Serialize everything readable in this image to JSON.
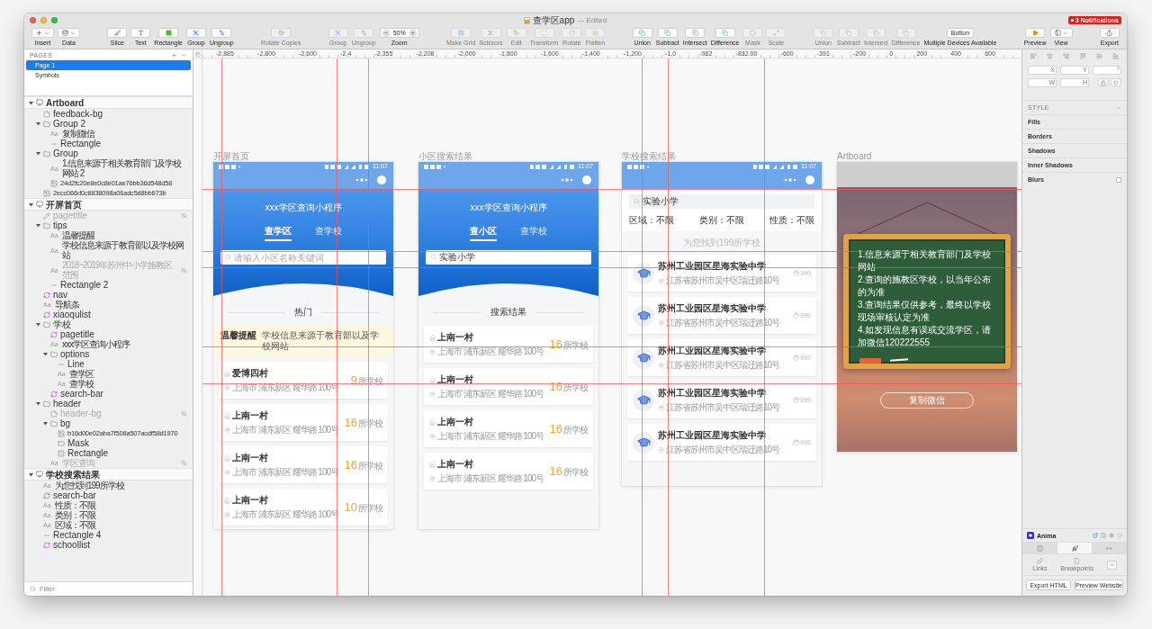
{
  "window": {
    "title": "查学区app",
    "status": "— Edited",
    "notifications": "3 Notifications"
  },
  "toolbar": [
    {
      "items": [
        {
          "label": "Insert",
          "kind": "dropdown",
          "disabled": false
        },
        {
          "label": "Data",
          "kind": "dropdown",
          "disabled": false
        }
      ]
    },
    {
      "items": [
        {
          "label": "Slice",
          "kind": "tool",
          "disabled": false
        },
        {
          "label": "Text",
          "kind": "tool",
          "disabled": false
        },
        {
          "label": "Rectangle",
          "kind": "tool",
          "disabled": false
        },
        {
          "label": "Group",
          "kind": "tool",
          "disabled": false
        },
        {
          "label": "Ungroup",
          "kind": "tool",
          "disabled": false
        }
      ]
    },
    {
      "items": [
        {
          "label": "Rotate Copies",
          "kind": "tool",
          "disabled": true
        }
      ]
    },
    {
      "items": [
        {
          "label": "Group",
          "kind": "tool",
          "disabled": true
        },
        {
          "label": "Ungroup",
          "kind": "tool",
          "disabled": true
        },
        {
          "label": "Zoom",
          "kind": "zoom",
          "value": "50%",
          "disabled": false
        }
      ]
    },
    {
      "items": [
        {
          "label": "Make Grid",
          "kind": "tool",
          "disabled": true
        },
        {
          "label": "Scissors",
          "kind": "tool",
          "disabled": true
        },
        {
          "label": "Edit",
          "kind": "tool",
          "disabled": true
        },
        {
          "label": "Transform",
          "kind": "tool",
          "disabled": true
        },
        {
          "label": "Rotate",
          "kind": "tool",
          "disabled": true
        },
        {
          "label": "Flatten",
          "kind": "tool",
          "disabled": true
        }
      ]
    },
    {
      "items": [
        {
          "label": "Union",
          "kind": "tool",
          "disabled": false
        },
        {
          "label": "Subtract",
          "kind": "tool",
          "disabled": false
        },
        {
          "label": "Intersect",
          "kind": "tool",
          "disabled": false
        },
        {
          "label": "Difference",
          "kind": "tool",
          "disabled": false
        },
        {
          "label": "Mask",
          "kind": "tool",
          "disabled": true
        },
        {
          "label": "Scale",
          "kind": "tool",
          "disabled": true
        }
      ]
    },
    {
      "items": [
        {
          "label": "Union",
          "kind": "tool",
          "disabled": true
        },
        {
          "label": "Subtract",
          "kind": "tool",
          "disabled": true
        },
        {
          "label": "Intersect",
          "kind": "tool",
          "disabled": true
        },
        {
          "label": "Difference",
          "kind": "tool",
          "disabled": true
        },
        {
          "label": "Multiple Devices Available",
          "kind": "text-button",
          "button": "Button",
          "disabled": false
        }
      ]
    },
    {
      "items": [
        {
          "label": "Preview",
          "kind": "tool",
          "disabled": false
        },
        {
          "label": "View",
          "kind": "dropdown",
          "disabled": false
        }
      ]
    },
    {
      "items": [
        {
          "label": "Export",
          "kind": "tool",
          "disabled": false
        }
      ]
    }
  ],
  "ruler": [
    "-2,885",
    "-2,800",
    "-2,600",
    "-2,4",
    "-2,355",
    "-2,208",
    "-2,000",
    "-1,800",
    "-1,600",
    "-1,400",
    "-1,200",
    "-1,0",
    "-962",
    "-832.00",
    "-600",
    "-391",
    "-200",
    "0",
    "200",
    "400",
    "600"
  ],
  "pages": {
    "title": "PAGES",
    "items": [
      {
        "label": "Page 1",
        "selected": true
      },
      {
        "label": "Symbols",
        "selected": false
      }
    ]
  },
  "layers": [
    {
      "name": "Artboard",
      "kind": "artboard",
      "hidden": false,
      "expanded": true,
      "children": [
        {
          "name": "feedback-bg",
          "kind": "style",
          "hidden": false
        },
        {
          "name": "Group 2",
          "kind": "group",
          "hidden": false,
          "expanded": true,
          "children": [
            {
              "name": "复制微信",
              "kind": "text",
              "glyph": "Aa",
              "hidden": false
            },
            {
              "name": "Rectangle",
              "kind": "line",
              "hidden": false
            }
          ]
        },
        {
          "name": "Group",
          "kind": "group",
          "hidden": false,
          "expanded": true,
          "children": [
            {
              "name": "1.信息来源于相关教育部门及学校网站 2",
              "kind": "text",
              "glyph": "Aa",
              "hidden": false
            },
            {
              "name": "24d2fc20e8e0c8e01ae76bb36d548d58",
              "kind": "image",
              "hidden": false
            }
          ]
        },
        {
          "name": "2ecc066d0c8838098a06adc5d8bb673b",
          "kind": "image",
          "hidden": false
        }
      ]
    },
    {
      "name": "开屏首页",
      "kind": "artboard",
      "hidden": false,
      "expanded": true,
      "children": [
        {
          "name": "pagetitle",
          "kind": "slice",
          "hidden": true
        },
        {
          "name": "tips",
          "kind": "group",
          "hidden": false,
          "expanded": true,
          "children": [
            {
              "name": "温馨提醒",
              "kind": "text",
              "glyph": "Aa",
              "hidden": false
            },
            {
              "name": "学校信息来源于教育部以及学校网站",
              "kind": "text",
              "glyph": "Aa",
              "hidden": false
            },
            {
              "name": "2018~2019年苏州中小学施教区范围",
              "kind": "text",
              "glyph": "Aa",
              "hidden": true
            },
            {
              "name": "Rectangle 2",
              "kind": "line",
              "hidden": false
            }
          ]
        },
        {
          "name": "nav",
          "kind": "symbol",
          "hidden": false
        },
        {
          "name": "导航条",
          "kind": "text",
          "glyph": "Aa",
          "hidden": false
        },
        {
          "name": "xiaoqulist",
          "kind": "symbol",
          "hidden": false
        },
        {
          "name": "学校",
          "kind": "group",
          "hidden": false,
          "expanded": true,
          "children": [
            {
              "name": "pagetitle",
              "kind": "symbol",
              "hidden": false
            },
            {
              "name": "xxx学区查询小程序",
              "kind": "text",
              "glyph": "Aa",
              "hidden": false
            },
            {
              "name": "options",
              "kind": "group",
              "hidden": false,
              "expanded": true,
              "children": [
                {
                  "name": "Line",
                  "kind": "line",
                  "hidden": false
                },
                {
                  "name": "查学区",
                  "kind": "text",
                  "glyph": "Aa",
                  "hidden": false
                },
                {
                  "name": "查学校",
                  "kind": "text",
                  "glyph": "Aa",
                  "hidden": false
                }
              ]
            },
            {
              "name": "search-bar",
              "kind": "symbol",
              "hidden": false
            }
          ]
        },
        {
          "name": "header",
          "kind": "group",
          "hidden": false,
          "expanded": true,
          "children": [
            {
              "name": "header-bg",
              "kind": "style",
              "hidden": true
            },
            {
              "name": "bg",
              "kind": "group",
              "hidden": false,
              "expanded": true,
              "children": [
                {
                  "name": "b16d00e02aba7f508a507acdf58d1970",
                  "kind": "image",
                  "hidden": false
                },
                {
                  "name": "Mask",
                  "kind": "mask",
                  "hidden": false
                },
                {
                  "name": "Rectangle",
                  "kind": "rectangle",
                  "hidden": false
                }
              ]
            },
            {
              "name": "学区查询",
              "kind": "text",
              "glyph": "Aa",
              "hidden": true
            }
          ]
        }
      ]
    },
    {
      "name": "学校搜索结果",
      "kind": "artboard",
      "hidden": false,
      "expanded": true,
      "children": [
        {
          "name": "为您找到199所学校",
          "kind": "text",
          "glyph": "Aa",
          "hidden": false
        },
        {
          "name": "search-bar",
          "kind": "symbol",
          "hidden": false
        },
        {
          "name": "性质：不限",
          "kind": "text",
          "glyph": "Aa",
          "hidden": false
        },
        {
          "name": "类别：不限",
          "kind": "text",
          "glyph": "Aa",
          "hidden": false
        },
        {
          "name": "区域：不限",
          "kind": "text",
          "glyph": "Aa",
          "hidden": false
        },
        {
          "name": "Rectangle 4",
          "kind": "line",
          "hidden": false
        },
        {
          "name": "schoollist",
          "kind": "symbol",
          "hidden": false
        }
      ]
    }
  ],
  "filter": {
    "placeholder": "Filter"
  },
  "artboards": [
    {
      "label": "开屏首页",
      "kind": "home",
      "time": "11:07",
      "title": "xxx学区查询小程序",
      "tabs": [
        {
          "label": "查学区",
          "selected": true
        },
        {
          "label": "查学校",
          "selected": false
        }
      ],
      "search": {
        "placeholder": "请输入小区名称关键词"
      },
      "section": "热门",
      "tip": {
        "label": "温馨提醒",
        "text": "学校信息来源于教育部以及学校网站"
      },
      "items": [
        {
          "name": "爱博四村",
          "address": "上海市 浦东新区 耀华路 100号",
          "count": "9",
          "unit": "所学校"
        },
        {
          "name": "上南一村",
          "address": "上海市 浦东新区 耀华路 100号",
          "count": "16",
          "unit": "所学校"
        },
        {
          "name": "上南一村",
          "address": "上海市 浦东新区 耀华路 100号",
          "count": "16",
          "unit": "所学校"
        },
        {
          "name": "上南一村",
          "address": "上海市 浦东新区 耀华路 100号",
          "count": "10",
          "unit": "所学校"
        }
      ]
    },
    {
      "label": "小区搜索结果",
      "kind": "home",
      "time": "11:07",
      "title": "xxx学区查询小程序",
      "tabs": [
        {
          "label": "查小区",
          "selected": true
        },
        {
          "label": "查学校",
          "selected": false
        }
      ],
      "search": {
        "value": "实验小学"
      },
      "section": "搜索结果",
      "items": [
        {
          "name": "上南一村",
          "address": "上海市 浦东新区 耀华路 100号",
          "count": "16",
          "unit": "所学校"
        },
        {
          "name": "上南一村",
          "address": "上海市 浦东新区 耀华路 100号",
          "count": "16",
          "unit": "所学校"
        },
        {
          "name": "上南一村",
          "address": "上海市 浦东新区 耀华路 100号",
          "count": "16",
          "unit": "所学校"
        },
        {
          "name": "上南一村",
          "address": "上海市 浦东新区 耀华路 100号",
          "count": "16",
          "unit": "所学校"
        }
      ]
    },
    {
      "label": "学校搜索结果",
      "kind": "schools",
      "time": "11:07",
      "search": {
        "value": "实验小学"
      },
      "filters": [
        "区域：不限",
        "类别：不限",
        "性质：不限"
      ],
      "summary": "为您找到199所学校",
      "schools": [
        {
          "name": "苏州工业园区星海实验中学",
          "address": "江苏省苏州市吴中区瑞迁路10号",
          "count": "999"
        },
        {
          "name": "苏州工业园区星海实验中学",
          "address": "江苏省苏州市吴中区瑞迁路10号",
          "count": "999"
        },
        {
          "name": "苏州工业园区星海实验中学",
          "address": "江苏省苏州市吴中区瑞迁路10号",
          "count": "999"
        },
        {
          "name": "苏州工业园区星海实验中学",
          "address": "江苏省苏州市吴中区瑞迁路10号",
          "count": "999"
        },
        {
          "name": "苏州工业园区星海实验中学",
          "address": "江苏省苏州市吴中区瑞迁路10号",
          "count": "999"
        }
      ]
    },
    {
      "label": "Artboard",
      "kind": "notice",
      "notes": [
        "1.信息来源于相关教育部门及学校网站",
        "2.查询的施教区学校，以当年公布的为准",
        "3.查询结果仅供参考，最终以学校现场审核认定为准",
        "4.如发现信息有误或交流学区，请加微信120222555"
      ],
      "button": "复制微信"
    }
  ],
  "inspector": {
    "fields": [
      {
        "label": "X"
      },
      {
        "label": "Y"
      },
      {
        "label": "°"
      },
      {
        "label": "W"
      },
      {
        "label": "H"
      }
    ],
    "style_title": "STYLE",
    "sections": [
      {
        "label": "Fills",
        "kind": "plain"
      },
      {
        "label": "Borders",
        "kind": "plain"
      },
      {
        "label": "Shadows",
        "kind": "plain"
      },
      {
        "label": "Inner Shadows",
        "kind": "plain"
      },
      {
        "label": "Blurs",
        "kind": "toggle",
        "checked": false
      }
    ]
  },
  "anima": {
    "title": "Anima",
    "tabs": [
      {
        "selected": false
      },
      {
        "selected": true
      },
      {
        "selected": false
      }
    ],
    "tools": [
      "Links",
      "Breakpoints"
    ],
    "buttons": [
      "Export HTML",
      "Preview Website"
    ]
  }
}
